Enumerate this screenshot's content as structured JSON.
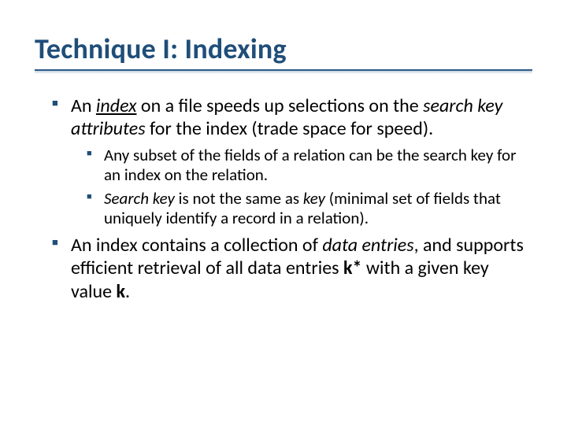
{
  "title": "Technique I: Indexing",
  "b1": {
    "pre": "An ",
    "index": "index",
    "mid": " on a file speeds up selections on the ",
    "ska": "search key attributes",
    "post": " for the index (trade space for speed)."
  },
  "b1a": "Any subset of the fields of a relation can be the search key for an index on the relation.",
  "b1b": {
    "sk": "Search key",
    "mid": " is not the same as ",
    "key": "key",
    "post": " (minimal set of fields that uniquely identify a record in a relation)."
  },
  "b2": {
    "pre": "An index contains a collection of ",
    "de": "data entries",
    "mid1": ", and supports efficient retrieval of all data entries ",
    "kstar": "k*",
    "mid2": " with a given key value ",
    "k": "k",
    "post": "."
  }
}
